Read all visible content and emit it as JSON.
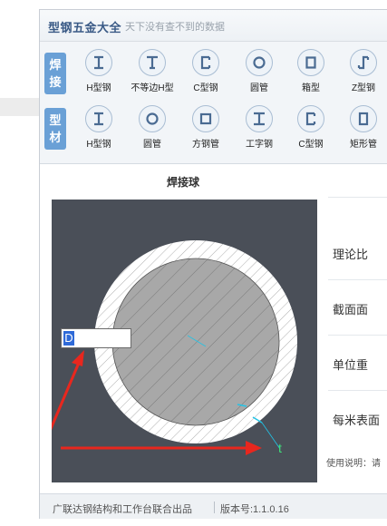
{
  "app": {
    "title": "型钢五金大全",
    "subtitle": "天下没有查不到的数据"
  },
  "toolbar": {
    "weld_badge": [
      "焊",
      "接"
    ],
    "profile_badge": [
      "型",
      "材"
    ],
    "weld_items": [
      {
        "label": "H型钢",
        "icon": "h-beam-icon"
      },
      {
        "label": "不等边H型",
        "icon": "unequal-h-beam-icon"
      },
      {
        "label": "C型钢",
        "icon": "c-channel-icon"
      },
      {
        "label": "圆管",
        "icon": "round-pipe-icon"
      },
      {
        "label": "箱型",
        "icon": "box-section-icon"
      },
      {
        "label": "Z型钢",
        "icon": "z-section-icon"
      }
    ],
    "profile_items": [
      {
        "label": "H型钢",
        "icon": "h-beam-icon"
      },
      {
        "label": "圆管",
        "icon": "round-pipe-icon"
      },
      {
        "label": "方钢管",
        "icon": "square-tube-icon"
      },
      {
        "label": "工字钢",
        "icon": "i-beam-icon"
      },
      {
        "label": "C型钢",
        "icon": "c-channel-icon"
      },
      {
        "label": "矩形管",
        "icon": "rect-tube-icon"
      }
    ]
  },
  "main": {
    "section_title": "焊接球",
    "diagram": {
      "d_label": "D",
      "t_label": "t",
      "d_field_value": ""
    },
    "properties": [
      "理论比",
      "截面面",
      "单位重",
      "每米表面"
    ],
    "usage_note": "使用说明：请"
  },
  "statusbar": {
    "publisher": "广联达钢结构和工作台联合出品",
    "version": "版本号:1.1.0.16"
  },
  "colors": {
    "accent": "#6aa0d6",
    "canvas": "#4a4f58",
    "arrow": "#e8271e",
    "dimension": "#22c3e6"
  }
}
